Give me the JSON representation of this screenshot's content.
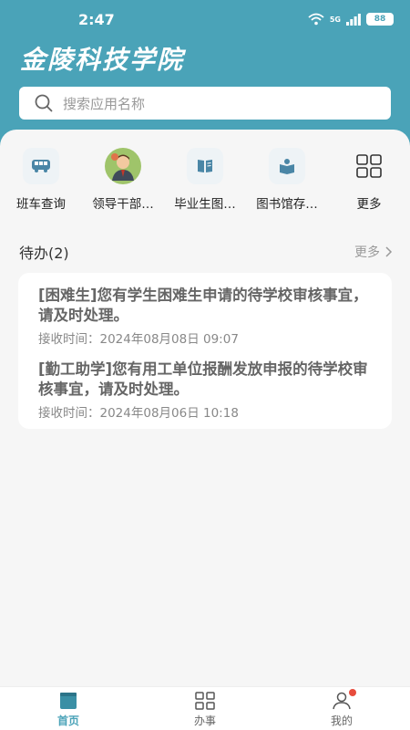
{
  "status_bar": {
    "time": "2:47",
    "signal_label": "5G",
    "battery": "88"
  },
  "header": {
    "logo_text": "金陵科技学院"
  },
  "search": {
    "placeholder": "搜索应用名称"
  },
  "apps": [
    {
      "label": "班车查询",
      "icon": "bus-icon"
    },
    {
      "label": "领导干部…",
      "icon": "leader-avatar-icon"
    },
    {
      "label": "毕业生图…",
      "icon": "book-icon"
    },
    {
      "label": "图书馆存…",
      "icon": "library-icon"
    },
    {
      "label": "更多",
      "icon": "grid-icon"
    }
  ],
  "todo": {
    "title": "待办(2)",
    "more_label": "更多",
    "items": [
      {
        "text": "[困难生]您有学生困难生申请的待学校审核事宜，请及时处理。",
        "time": "接收时间：2024年08月08日 09:07"
      },
      {
        "text": "[勤工助学]您有用工单位报酬发放申报的待学校审核事宜，请及时处理。",
        "time": "接收时间：2024年08月06日 10:18"
      }
    ]
  },
  "tabbar": {
    "tabs": [
      {
        "label": "首页",
        "icon": "home-icon",
        "active": true
      },
      {
        "label": "办事",
        "icon": "grid-icon",
        "active": false
      },
      {
        "label": "我的",
        "icon": "user-icon",
        "active": false
      }
    ]
  },
  "colors": {
    "accent": "#4aa3b8",
    "badge": "#e74c3c"
  }
}
